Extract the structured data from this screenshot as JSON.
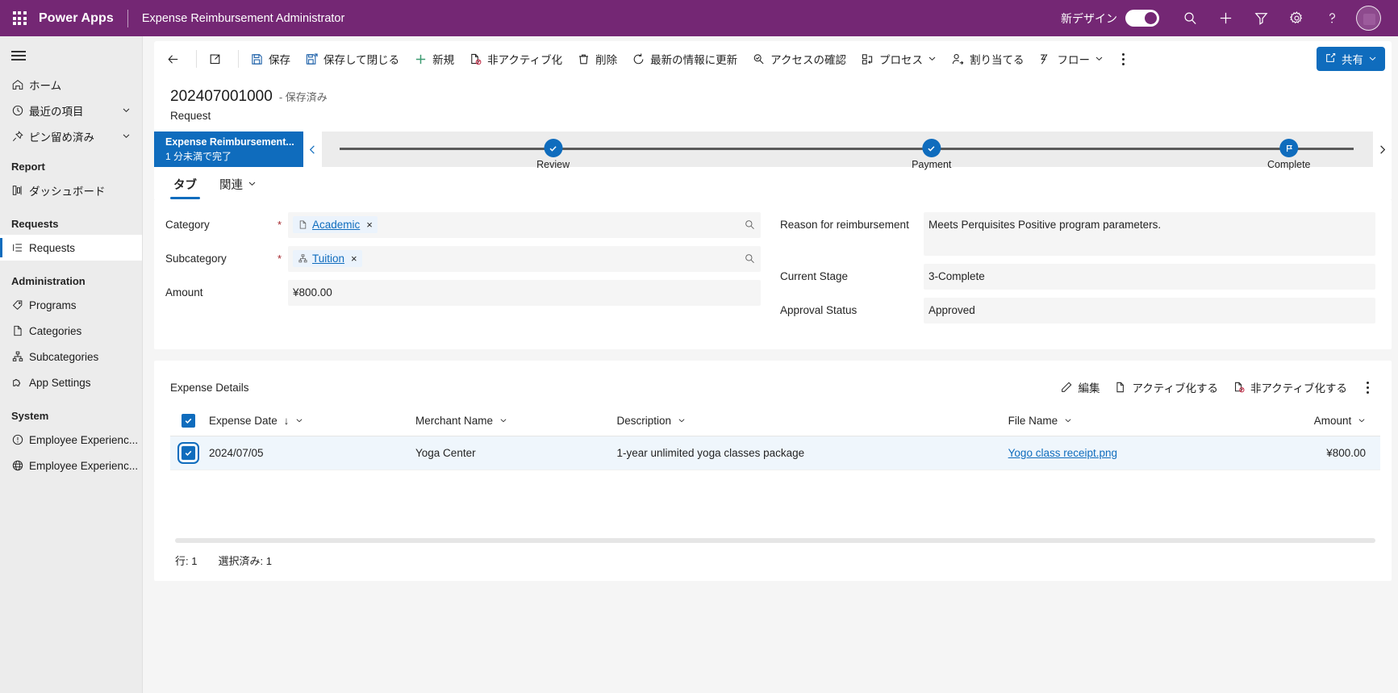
{
  "appbar": {
    "waffle": "app-launcher",
    "brand": "Power Apps",
    "app_name": "Expense Reimbursement Administrator",
    "new_design_label": "新デザイン",
    "toggle_state": "on",
    "icons": [
      "search-icon",
      "add-icon",
      "filter-icon",
      "settings-icon",
      "help-icon",
      "avatar"
    ],
    "brand_color": "#742774"
  },
  "sidebar": {
    "hamburger": "menu-icon",
    "items": [
      {
        "label": "ホーム",
        "icon": "home-icon",
        "expandable": false
      },
      {
        "label": "最近の項目",
        "icon": "clock-icon",
        "expandable": true
      },
      {
        "label": "ピン留め済み",
        "icon": "pin-icon",
        "expandable": true
      }
    ],
    "groups": [
      {
        "title": "Report",
        "items": [
          {
            "label": "ダッシュボード",
            "icon": "dashboard-icon",
            "selected": false
          }
        ]
      },
      {
        "title": "Requests",
        "items": [
          {
            "label": "Requests",
            "icon": "list-icon",
            "selected": true
          }
        ]
      },
      {
        "title": "Administration",
        "items": [
          {
            "label": "Programs",
            "icon": "tag-icon",
            "selected": false
          },
          {
            "label": "Categories",
            "icon": "document-icon",
            "selected": false
          },
          {
            "label": "Subcategories",
            "icon": "hierarchy-icon",
            "selected": false
          },
          {
            "label": "App Settings",
            "icon": "puzzle-icon",
            "selected": false
          }
        ]
      },
      {
        "title": "System",
        "items": [
          {
            "label": "Employee Experienc...",
            "icon": "info-icon",
            "selected": false
          },
          {
            "label": "Employee Experienc...",
            "icon": "globe-icon",
            "selected": false
          }
        ]
      }
    ]
  },
  "commandbar": {
    "back": "back-arrow-icon",
    "popout": "open-in-new-window-icon",
    "items": [
      {
        "label": "保存",
        "icon": "save-icon"
      },
      {
        "label": "保存して閉じる",
        "icon": "save-and-close-icon"
      },
      {
        "label": "新規",
        "icon": "add-icon"
      },
      {
        "label": "非アクティブ化",
        "icon": "deactivate-icon"
      },
      {
        "label": "削除",
        "icon": "trash-icon"
      },
      {
        "label": "最新の情報に更新",
        "icon": "refresh-icon"
      },
      {
        "label": "アクセスの確認",
        "icon": "check-access-icon"
      },
      {
        "label": "プロセス",
        "icon": "process-icon",
        "chevron": true
      },
      {
        "label": "割り当てる",
        "icon": "assign-user-icon"
      },
      {
        "label": "フロー",
        "icon": "flow-icon",
        "chevron": true
      }
    ],
    "overflow": "more-options-icon",
    "share": {
      "label": "共有",
      "icon": "share-icon",
      "chevron": true,
      "color": "#0f6cbd"
    }
  },
  "record": {
    "id": "202407001000",
    "state": "- 保存済み",
    "entity": "Request"
  },
  "bpf": {
    "active_stage_title": "Expense Reimbursement...",
    "active_stage_time": "1 分未満で完了",
    "prev_icon": "chevron-left-icon",
    "next_icon": "chevron-right-icon",
    "stages": [
      {
        "label": "Review",
        "icon": "check-icon",
        "pos": 22
      },
      {
        "label": "Payment",
        "icon": "check-icon",
        "pos": 58
      },
      {
        "label": "Complete",
        "icon": "flag-icon",
        "pos": 92
      }
    ]
  },
  "tabs": [
    {
      "label": "タブ",
      "active": true,
      "chevron": false
    },
    {
      "label": "関連",
      "active": false,
      "chevron": true
    }
  ],
  "form": {
    "left": [
      {
        "label": "Category",
        "required": true,
        "type": "lookup",
        "chip_icon": "document-icon",
        "value": "Academic",
        "remove": "×",
        "lookup_icon": "search-icon"
      },
      {
        "label": "Subcategory",
        "required": true,
        "type": "lookup",
        "chip_icon": "hierarchy-icon",
        "value": "Tuition",
        "remove": "×",
        "lookup_icon": "search-icon"
      },
      {
        "label": "Amount",
        "required": false,
        "type": "text",
        "value": "¥800.00"
      }
    ],
    "right": [
      {
        "label": "Reason for reimbursement",
        "type": "multiline",
        "value": "Meets Perquisites Positive program parameters."
      },
      {
        "label": "Current Stage",
        "type": "text",
        "value": "3-Complete"
      },
      {
        "label": "Approval Status",
        "type": "text",
        "value": "Approved"
      }
    ]
  },
  "grid": {
    "title": "Expense Details",
    "tools": [
      {
        "label": "編集",
        "icon": "edit-pencil-icon"
      },
      {
        "label": "アクティブ化する",
        "icon": "activate-icon"
      },
      {
        "label": "非アクティブ化する",
        "icon": "deactivate-icon"
      }
    ],
    "overflow": "more-options-icon",
    "columns": [
      {
        "label": "Expense Date",
        "sorted": true,
        "sort_dir": "↓",
        "align": "left"
      },
      {
        "label": "Merchant Name",
        "sorted": false,
        "align": "left"
      },
      {
        "label": "Description",
        "sorted": false,
        "align": "left"
      },
      {
        "label": "File Name",
        "sorted": false,
        "align": "left"
      },
      {
        "label": "Amount",
        "sorted": false,
        "align": "right"
      }
    ],
    "rows": [
      {
        "selected": true,
        "expense_date": "2024/07/05",
        "merchant_name": "Yoga Center",
        "description": "1-year unlimited yoga classes package",
        "file_name": "Yogo class receipt.png",
        "amount": "¥800.00"
      }
    ],
    "footer": {
      "rows_label": "行: 1",
      "selected_label": "選択済み: 1"
    }
  }
}
